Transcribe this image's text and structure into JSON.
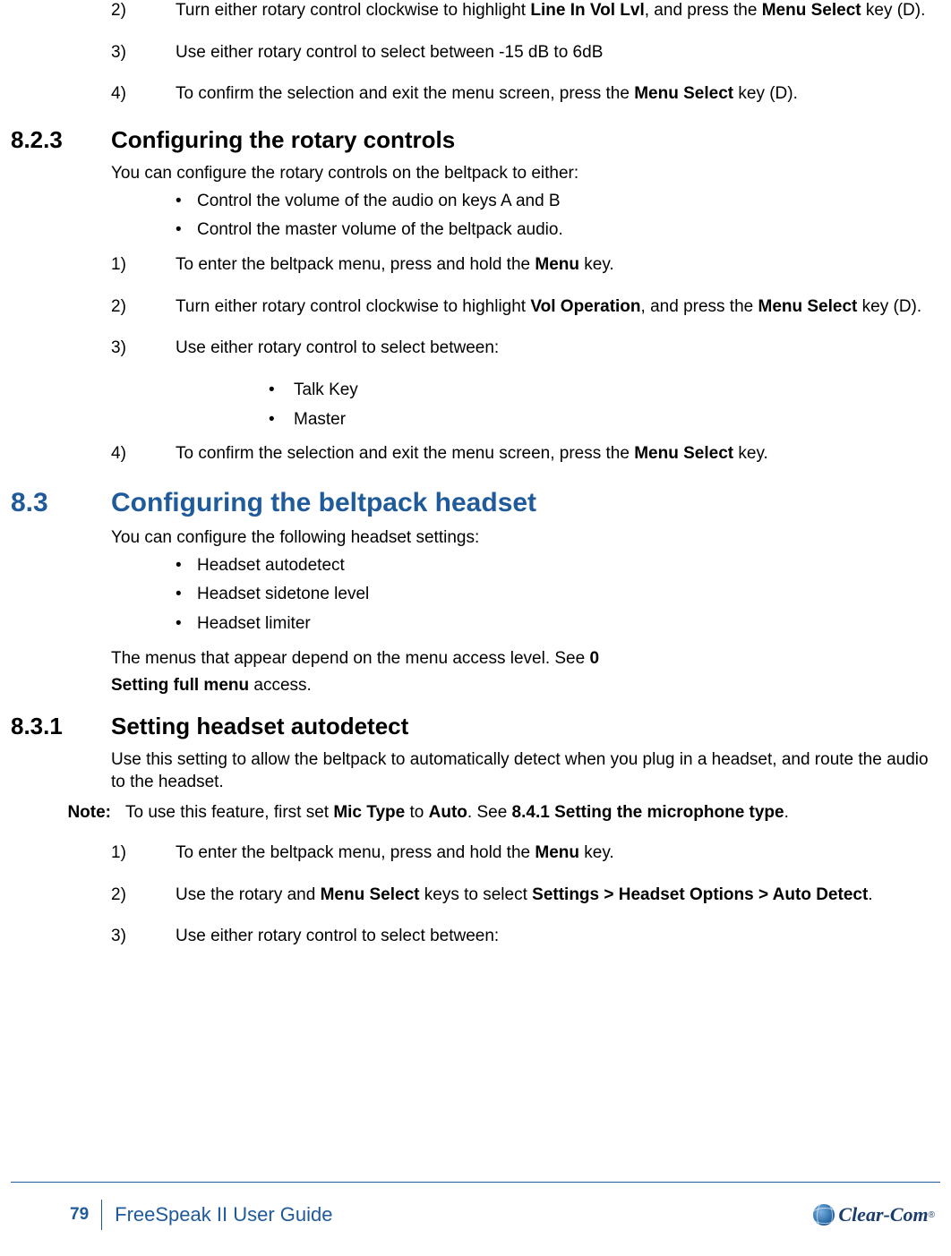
{
  "topSteps": [
    {
      "num": "2)",
      "html": "Turn either rotary control clockwise to highlight <b>Line In Vol Lvl</b>, and press the <b>Menu Select</b> key (D)."
    },
    {
      "num": "3)",
      "html": "Use either rotary control to select between -15 dB to 6dB"
    },
    {
      "num": "4)",
      "html": "To confirm the selection and exit the menu screen, press the <b>Menu Select</b> key (D)."
    }
  ],
  "sec823": {
    "num": "8.2.3",
    "title": "Configuring the rotary controls",
    "intro": "You can configure the rotary controls on the beltpack to either:",
    "bullets": [
      "Control the volume of the audio on keys A and B",
      "Control the master volume of the beltpack audio."
    ],
    "steps12": [
      {
        "num": "1)",
        "html": "To enter the beltpack menu, press and hold the <b>Menu</b> key."
      },
      {
        "num": "2)",
        "html": "Turn either rotary control clockwise to highlight <b>Vol Operation</b>, and press the <b>Menu Select</b> key (D)."
      }
    ],
    "step3": {
      "num": "3)",
      "html": "Use either rotary control to select between:"
    },
    "step3bullets": [
      "Talk Key",
      "Master"
    ],
    "step4": {
      "num": "4)",
      "html": "To confirm the selection and exit the menu screen, press the <b>Menu Select</b> key."
    }
  },
  "sec83": {
    "num": "8.3",
    "title": "Configuring the beltpack headset",
    "intro": "You can configure the following headset settings:",
    "bullets": [
      "Headset autodetect",
      "Headset sidetone level",
      "Headset limiter"
    ],
    "tail1": "The menus that appear depend on the menu access level. See <b>0</b>",
    "tail2": "<b>Setting full menu</b> access."
  },
  "sec831": {
    "num": "8.3.1",
    "title": "Setting headset autodetect",
    "intro": "Use this setting to allow the beltpack to automatically detect when you plug in a headset, and route the audio to the headset.",
    "noteLabel": "Note:",
    "noteBody": "To use this feature, first set <b>Mic Type</b> to <b>Auto</b>. See <b>8.4.1 Setting the microphone type</b>.",
    "steps": [
      {
        "num": "1)",
        "html": "To enter the beltpack menu, press and hold the <b>Menu</b> key."
      },
      {
        "num": "2)",
        "html": "Use the rotary and <b>Menu Select</b> keys to select <b>Settings > Headset Options > Auto Detect</b>."
      },
      {
        "num": "3)",
        "html": "Use either rotary control to select between:"
      }
    ]
  },
  "footer": {
    "page": "79",
    "title": "FreeSpeak II User Guide",
    "brand": "Clear-Com",
    "reg": "®"
  }
}
